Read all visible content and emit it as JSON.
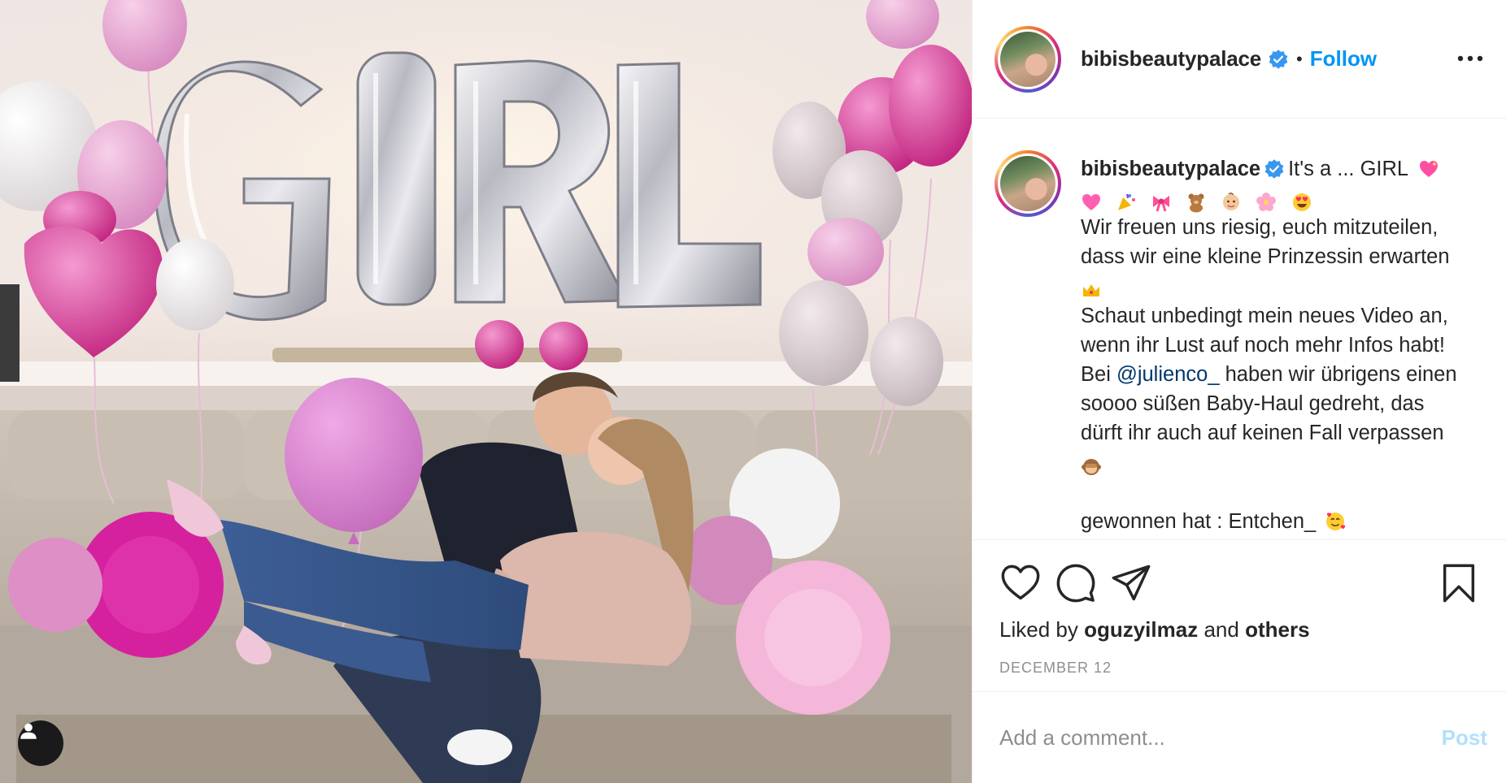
{
  "photo": {
    "balloon_letters": "GIRL"
  },
  "header": {
    "username": "bibisbeautypalace",
    "separator": "•",
    "follow_label": "Follow"
  },
  "caption": {
    "username": "bibisbeautypalace",
    "first_line": "It's a ... GIRL",
    "line_1": "Wir freuen uns riesig, euch mitzuteilen,",
    "line_2": "dass wir eine kleine Prinzessin erwarten",
    "line_3": "Schaut unbedingt mein neues Video an,",
    "line_4": "wenn ihr Lust auf noch mehr Infos habt!",
    "line_5_prefix": "Bei",
    "mention": "@julienco_",
    "line_5_suffix": "haben wir übrigens einen",
    "line_6": "soooo süßen Baby-Haul gedreht, das",
    "line_7": "dürft ihr auch auf keinen Fall verpassen",
    "line_8": "gewonnen hat : Entchen_"
  },
  "actions": {
    "liked_by_prefix": "Liked by",
    "liked_by_user": "oguzyilmaz",
    "liked_by_and": "and",
    "liked_by_others": "others",
    "date": "DECEMBER 12"
  },
  "comment": {
    "placeholder": "Add a comment...",
    "post_label": "Post"
  },
  "colors": {
    "accent": "#0095f6",
    "post_disabled": "#b2dffc",
    "mention": "#00376b",
    "secondary_text": "#8e8e8e"
  }
}
